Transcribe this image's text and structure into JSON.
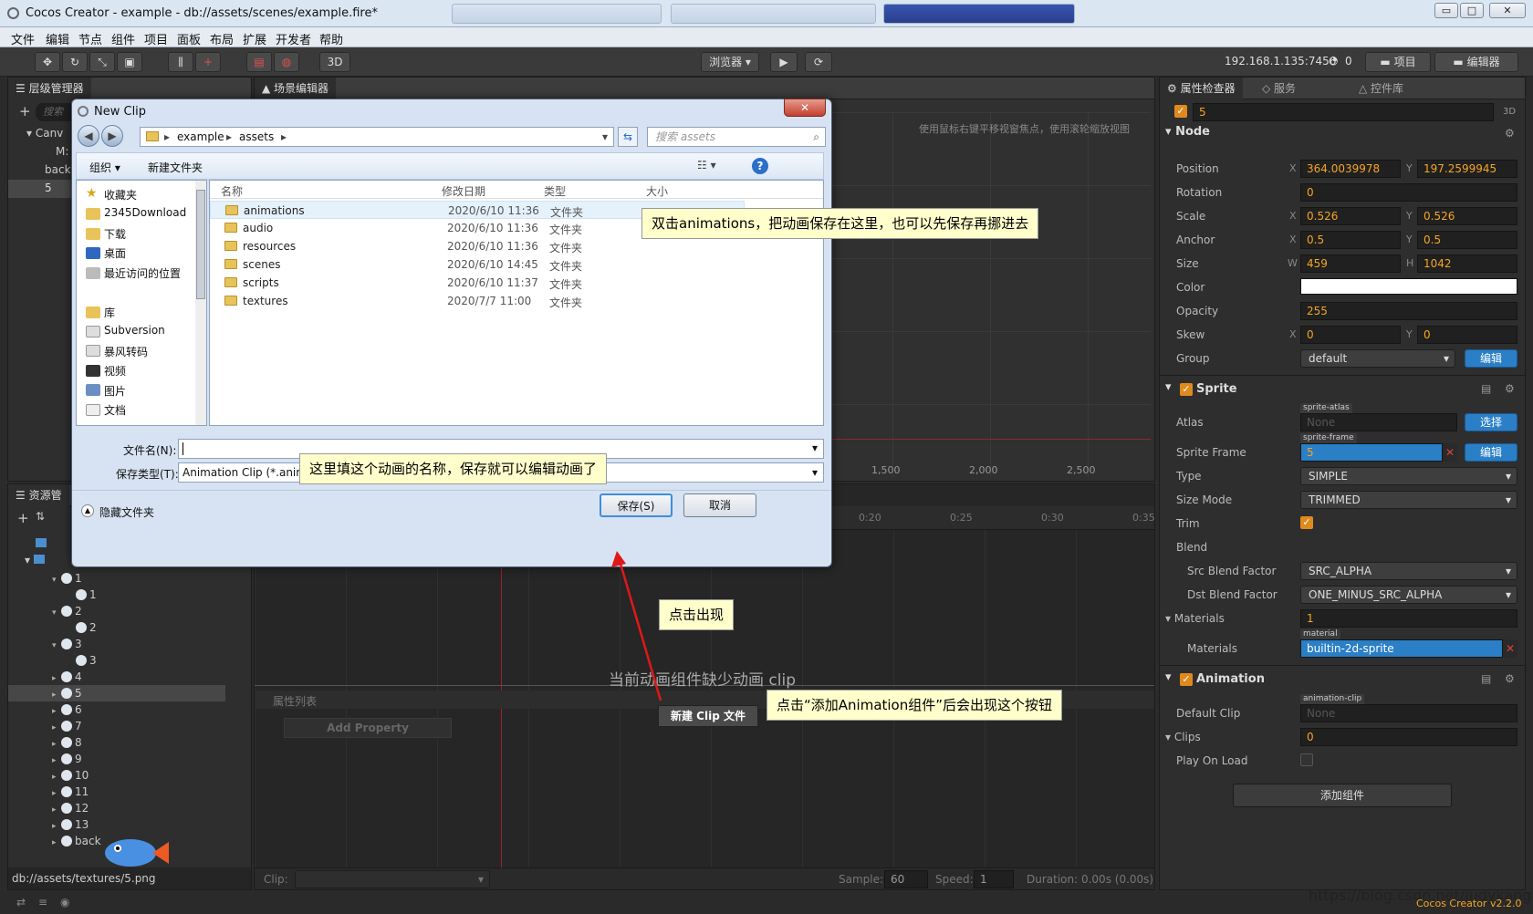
{
  "window": {
    "title": "Cocos Creator - example - db://assets/scenes/example.fire*",
    "min": "▭",
    "max": "□",
    "close": "✕"
  },
  "menu": [
    "文件",
    "编辑",
    "节点",
    "组件",
    "项目",
    "面板",
    "布局",
    "扩展",
    "开发者",
    "帮助"
  ],
  "toolbar": {
    "preview": "浏览器 ▾",
    "three_d": "3D",
    "ip": "192.168.1.135:7456",
    "count": "0",
    "project": "项目",
    "editor": "编辑器"
  },
  "hierarchy": {
    "title": "层级管理器",
    "search_placeholder": "搜索",
    "items": [
      "Canv",
      "M:",
      "back",
      "5"
    ]
  },
  "scene": {
    "title": "场景编辑器",
    "hint": "使用鼠标右键平移视窗焦点，使用滚轮缩放视图",
    "ruler": [
      "1,500",
      "2,000",
      "2,500"
    ]
  },
  "assets": {
    "title": "资源管",
    "path": "db://assets/textures/5.png",
    "items": [
      {
        "label": "1",
        "child": "1"
      },
      {
        "label": "2",
        "child": "2"
      },
      {
        "label": "3",
        "child": "3"
      },
      {
        "label": "4"
      },
      {
        "label": "5"
      },
      {
        "label": "6"
      },
      {
        "label": "7"
      },
      {
        "label": "8"
      },
      {
        "label": "9"
      },
      {
        "label": "10"
      },
      {
        "label": "11"
      },
      {
        "label": "12"
      },
      {
        "label": "13"
      },
      {
        "label": "back"
      }
    ]
  },
  "timeline": {
    "times": [
      "0:20",
      "0:25",
      "0:30",
      "0:35"
    ],
    "missing_clip": "当前动画组件缺少动画 clip",
    "new_clip_button": "新建 Clip 文件",
    "prop_list": "属性列表",
    "add_property": "Add Property",
    "clip_label": "Clip:",
    "sample_label": "Sample:",
    "sample": "60",
    "speed_label": "Speed:",
    "speed": "1",
    "duration": "Duration: 0.00s (0.00s)"
  },
  "inspector": {
    "tabs": [
      "属性检查器",
      "服务",
      "控件库"
    ],
    "name": "5",
    "three_d": "3D",
    "node": {
      "title": "Node",
      "position_x": "364.0039978",
      "position_y": "197.2599945",
      "rotation": "0",
      "scale_x": "0.526",
      "scale_y": "0.526",
      "anchor_x": "0.5",
      "anchor_y": "0.5",
      "size_w": "459",
      "size_h": "1042",
      "opacity": "255",
      "skew_x": "0",
      "skew_y": "0",
      "group": "default",
      "labels": [
        "Position",
        "Rotation",
        "Scale",
        "Anchor",
        "Size",
        "Color",
        "Opacity",
        "Skew",
        "Group"
      ]
    },
    "edit": "编辑",
    "select": "选择",
    "sprite": {
      "title": "Sprite",
      "atlas_label": "Atlas",
      "atlas_tag": "sprite-atlas",
      "atlas": "None",
      "frame_label": "Sprite Frame",
      "frame_tag": "sprite-frame",
      "frame": "5",
      "type_label": "Type",
      "type": "SIMPLE",
      "sizemode_label": "Size Mode",
      "sizemode": "TRIMMED",
      "trim_label": "Trim",
      "blend_label": "Blend",
      "src_label": "Src Blend Factor",
      "src": "SRC_ALPHA",
      "dst_label": "Dst Blend Factor",
      "dst": "ONE_MINUS_SRC_ALPHA",
      "materials_label": "Materials",
      "materials_count": "1",
      "material_tag": "material",
      "material_item_label": "Materials",
      "material": "builtin-2d-sprite"
    },
    "animation": {
      "title": "Animation",
      "clip_tag": "animation-clip",
      "default_clip_label": "Default Clip",
      "default_clip": "None",
      "clips_label": "Clips",
      "clips": "0",
      "playonload_label": "Play On Load"
    },
    "add_component": "添加组件"
  },
  "dialog": {
    "title": "New Clip",
    "close": "✕",
    "breadcrumb": [
      "example",
      "assets"
    ],
    "search_placeholder": "搜索 assets",
    "organize": "组织 ▾",
    "new_folder": "新建文件夹",
    "nav": {
      "favorites": "收藏夹",
      "fav_items": [
        "2345Download",
        "下载",
        "桌面",
        "最近访问的位置"
      ],
      "library": "库",
      "lib_items": [
        "Subversion",
        "暴风转码",
        "视频",
        "图片",
        "文档"
      ]
    },
    "columns": [
      "名称",
      "修改日期",
      "类型",
      "大小"
    ],
    "files": [
      {
        "name": "animations",
        "date": "2020/6/10 11:36",
        "type": "文件夹"
      },
      {
        "name": "audio",
        "date": "2020/6/10 11:36",
        "type": "文件夹"
      },
      {
        "name": "resources",
        "date": "2020/6/10 11:36",
        "type": "文件夹"
      },
      {
        "name": "scenes",
        "date": "2020/6/10 14:45",
        "type": "文件夹"
      },
      {
        "name": "scripts",
        "date": "2020/6/10 11:37",
        "type": "文件夹"
      },
      {
        "name": "textures",
        "date": "2020/7/7 11:00",
        "type": "文件夹"
      }
    ],
    "filename_label": "文件名(N):",
    "filename": "",
    "filetype_label": "保存类型(T):",
    "filetype": "Animation Clip (*.anim)",
    "hide_folders": "隐藏文件夹",
    "save": "保存(S)",
    "cancel": "取消"
  },
  "callouts": {
    "c1": "双击animations，把动画保存在这里，也可以先保存再挪进去",
    "c2": "这里填这个动画的名称，保存就可以编辑动画了",
    "c3": "点击出现",
    "c4": "点击“添加Animation组件”后会出现这个按钮"
  },
  "footer": {
    "watermark": "https://blog.csdn.net/judykang123",
    "version": "Cocos Creator v2.2.0"
  }
}
